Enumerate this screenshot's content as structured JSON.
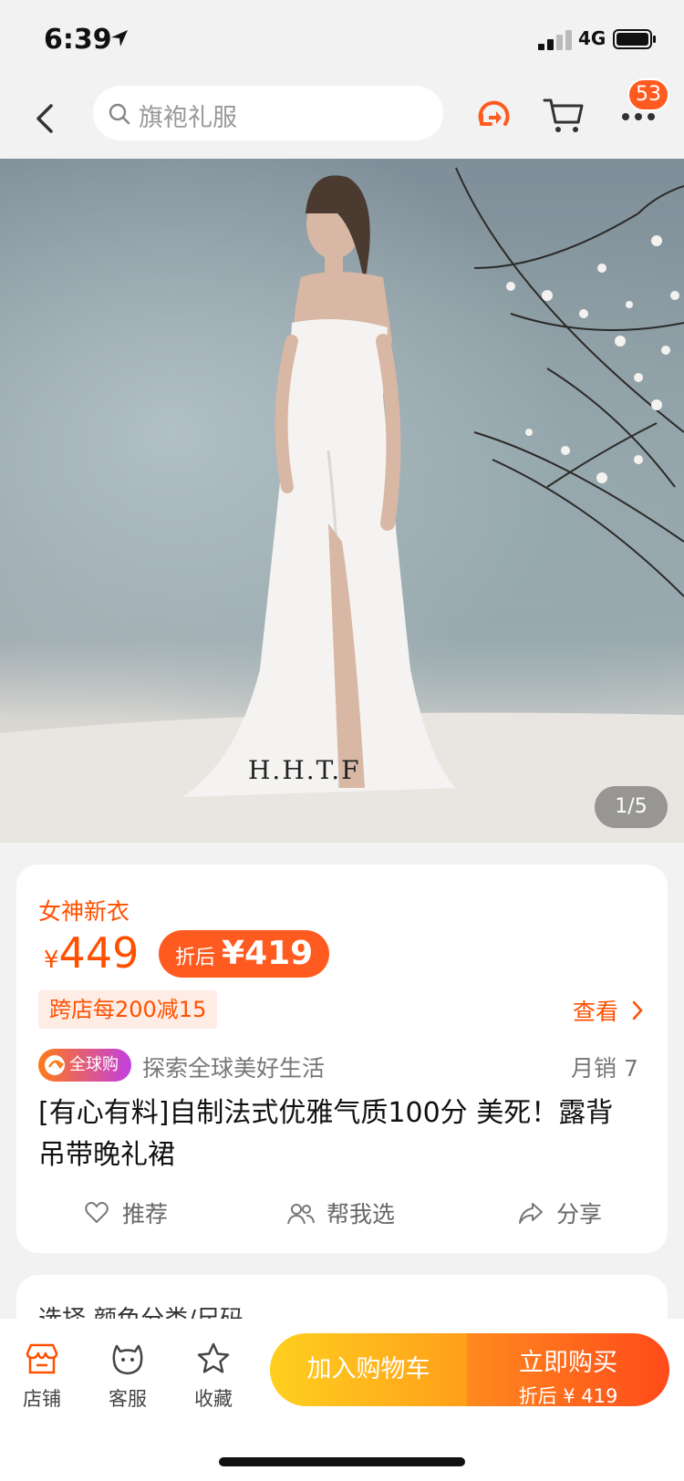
{
  "status_bar": {
    "time": "6:39",
    "network": "4G"
  },
  "nav": {
    "search_placeholder": "旗袍礼服",
    "notification_count": "53"
  },
  "gallery": {
    "counter": "1/5",
    "watermark": "H.H.T.F"
  },
  "product": {
    "promo_tag": "女神新衣",
    "currency": "¥",
    "price": "449",
    "after_discount_label": "折后",
    "after_discount_price": "¥419",
    "coupon": "跨店每200减15",
    "view_link": "查看",
    "global_badge": "全球购",
    "global_slogan": "探索全球美好生活",
    "monthly_sales": "月销  7",
    "title": "[有心有料]自制法式优雅气质100分 美死！露背吊带晚礼裙"
  },
  "actions": {
    "recommend": "推荐",
    "help_choose": "帮我选",
    "share": "分享"
  },
  "next_section": {
    "label": "选择   颜色分类/尺码"
  },
  "bottom_bar": {
    "store": "店铺",
    "service": "客服",
    "favorite": "收藏",
    "add_to_cart": "加入购物车",
    "buy_now": "立即购买",
    "buy_now_sub": "折后 ¥ 419"
  },
  "colors": {
    "accent": "#ff5000"
  }
}
